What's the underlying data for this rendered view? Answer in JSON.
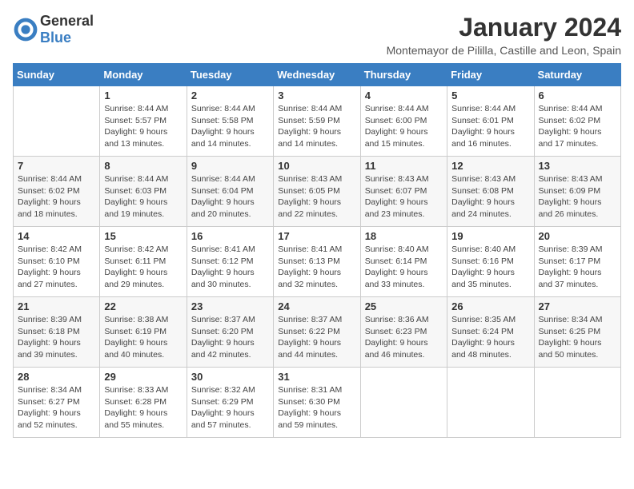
{
  "header": {
    "logo_general": "General",
    "logo_blue": "Blue",
    "month_year": "January 2024",
    "location": "Montemayor de Pililla, Castille and Leon, Spain"
  },
  "weekdays": [
    "Sunday",
    "Monday",
    "Tuesday",
    "Wednesday",
    "Thursday",
    "Friday",
    "Saturday"
  ],
  "weeks": [
    [
      {
        "day": "",
        "info": ""
      },
      {
        "day": "1",
        "info": "Sunrise: 8:44 AM\nSunset: 5:57 PM\nDaylight: 9 hours\nand 13 minutes."
      },
      {
        "day": "2",
        "info": "Sunrise: 8:44 AM\nSunset: 5:58 PM\nDaylight: 9 hours\nand 14 minutes."
      },
      {
        "day": "3",
        "info": "Sunrise: 8:44 AM\nSunset: 5:59 PM\nDaylight: 9 hours\nand 14 minutes."
      },
      {
        "day": "4",
        "info": "Sunrise: 8:44 AM\nSunset: 6:00 PM\nDaylight: 9 hours\nand 15 minutes."
      },
      {
        "day": "5",
        "info": "Sunrise: 8:44 AM\nSunset: 6:01 PM\nDaylight: 9 hours\nand 16 minutes."
      },
      {
        "day": "6",
        "info": "Sunrise: 8:44 AM\nSunset: 6:02 PM\nDaylight: 9 hours\nand 17 minutes."
      }
    ],
    [
      {
        "day": "7",
        "info": "Sunrise: 8:44 AM\nSunset: 6:02 PM\nDaylight: 9 hours\nand 18 minutes."
      },
      {
        "day": "8",
        "info": "Sunrise: 8:44 AM\nSunset: 6:03 PM\nDaylight: 9 hours\nand 19 minutes."
      },
      {
        "day": "9",
        "info": "Sunrise: 8:44 AM\nSunset: 6:04 PM\nDaylight: 9 hours\nand 20 minutes."
      },
      {
        "day": "10",
        "info": "Sunrise: 8:43 AM\nSunset: 6:05 PM\nDaylight: 9 hours\nand 22 minutes."
      },
      {
        "day": "11",
        "info": "Sunrise: 8:43 AM\nSunset: 6:07 PM\nDaylight: 9 hours\nand 23 minutes."
      },
      {
        "day": "12",
        "info": "Sunrise: 8:43 AM\nSunset: 6:08 PM\nDaylight: 9 hours\nand 24 minutes."
      },
      {
        "day": "13",
        "info": "Sunrise: 8:43 AM\nSunset: 6:09 PM\nDaylight: 9 hours\nand 26 minutes."
      }
    ],
    [
      {
        "day": "14",
        "info": "Sunrise: 8:42 AM\nSunset: 6:10 PM\nDaylight: 9 hours\nand 27 minutes."
      },
      {
        "day": "15",
        "info": "Sunrise: 8:42 AM\nSunset: 6:11 PM\nDaylight: 9 hours\nand 29 minutes."
      },
      {
        "day": "16",
        "info": "Sunrise: 8:41 AM\nSunset: 6:12 PM\nDaylight: 9 hours\nand 30 minutes."
      },
      {
        "day": "17",
        "info": "Sunrise: 8:41 AM\nSunset: 6:13 PM\nDaylight: 9 hours\nand 32 minutes."
      },
      {
        "day": "18",
        "info": "Sunrise: 8:40 AM\nSunset: 6:14 PM\nDaylight: 9 hours\nand 33 minutes."
      },
      {
        "day": "19",
        "info": "Sunrise: 8:40 AM\nSunset: 6:16 PM\nDaylight: 9 hours\nand 35 minutes."
      },
      {
        "day": "20",
        "info": "Sunrise: 8:39 AM\nSunset: 6:17 PM\nDaylight: 9 hours\nand 37 minutes."
      }
    ],
    [
      {
        "day": "21",
        "info": "Sunrise: 8:39 AM\nSunset: 6:18 PM\nDaylight: 9 hours\nand 39 minutes."
      },
      {
        "day": "22",
        "info": "Sunrise: 8:38 AM\nSunset: 6:19 PM\nDaylight: 9 hours\nand 40 minutes."
      },
      {
        "day": "23",
        "info": "Sunrise: 8:37 AM\nSunset: 6:20 PM\nDaylight: 9 hours\nand 42 minutes."
      },
      {
        "day": "24",
        "info": "Sunrise: 8:37 AM\nSunset: 6:22 PM\nDaylight: 9 hours\nand 44 minutes."
      },
      {
        "day": "25",
        "info": "Sunrise: 8:36 AM\nSunset: 6:23 PM\nDaylight: 9 hours\nand 46 minutes."
      },
      {
        "day": "26",
        "info": "Sunrise: 8:35 AM\nSunset: 6:24 PM\nDaylight: 9 hours\nand 48 minutes."
      },
      {
        "day": "27",
        "info": "Sunrise: 8:34 AM\nSunset: 6:25 PM\nDaylight: 9 hours\nand 50 minutes."
      }
    ],
    [
      {
        "day": "28",
        "info": "Sunrise: 8:34 AM\nSunset: 6:27 PM\nDaylight: 9 hours\nand 52 minutes."
      },
      {
        "day": "29",
        "info": "Sunrise: 8:33 AM\nSunset: 6:28 PM\nDaylight: 9 hours\nand 55 minutes."
      },
      {
        "day": "30",
        "info": "Sunrise: 8:32 AM\nSunset: 6:29 PM\nDaylight: 9 hours\nand 57 minutes."
      },
      {
        "day": "31",
        "info": "Sunrise: 8:31 AM\nSunset: 6:30 PM\nDaylight: 9 hours\nand 59 minutes."
      },
      {
        "day": "",
        "info": ""
      },
      {
        "day": "",
        "info": ""
      },
      {
        "day": "",
        "info": ""
      }
    ]
  ]
}
